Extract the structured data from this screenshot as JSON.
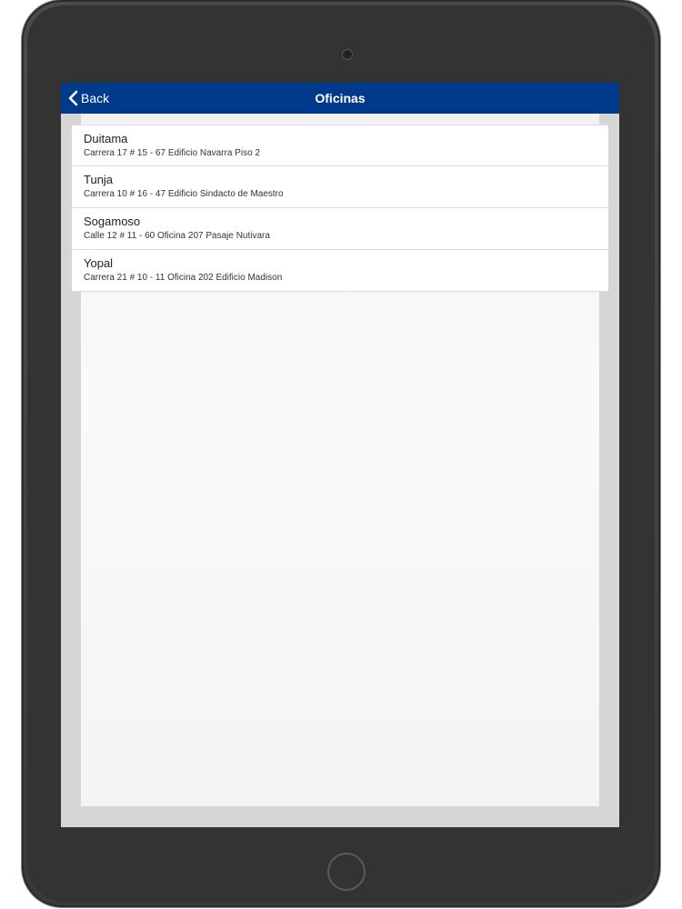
{
  "nav": {
    "back_label": "Back",
    "title": "Oficinas"
  },
  "offices": [
    {
      "name": "Duitama",
      "address": "Carrera 17 # 15 - 67 Edificio Navarra Piso 2"
    },
    {
      "name": "Tunja",
      "address": "Carrera 10 # 16 - 47 Edificio Sindacto de Maestro"
    },
    {
      "name": "Sogamoso",
      "address": "Calle 12 # 11 - 60 Oficina 207 Pasaje Nutivara"
    },
    {
      "name": "Yopal",
      "address": "Carrera 21 # 10 - 11 Oficina 202 Edificio Madison"
    }
  ],
  "colors": {
    "nav_background": "#003a8c",
    "nav_text": "#ffffff"
  },
  "icons": {
    "back": "chevron-left-icon"
  }
}
